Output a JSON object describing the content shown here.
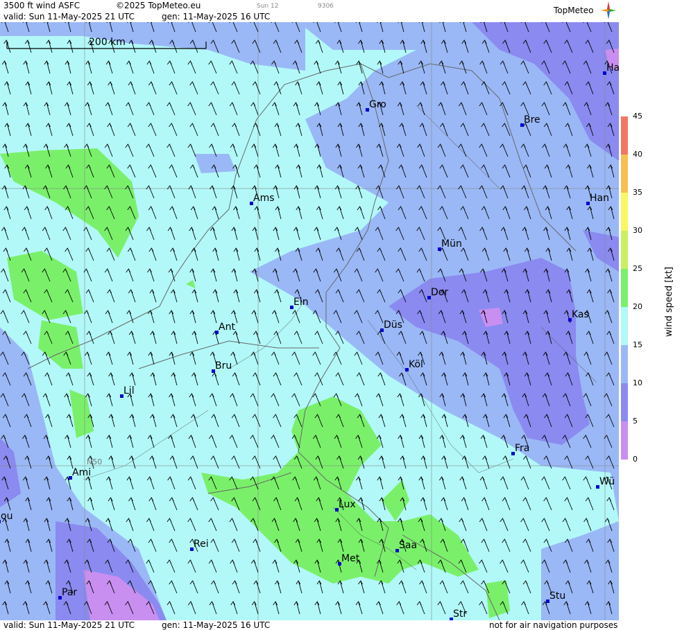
{
  "header": {
    "title": "3500 ft wind ASFC",
    "copyright": "©2025 TopMeteo.eu",
    "valid": "valid:  Sun  11-May-2025  21 UTC",
    "gen": "gen: 11-May-2025 16 UTC",
    "day_tag": "Sun 12",
    "code": "9306",
    "logo": "TopMeteo"
  },
  "footer": {
    "valid": "valid:  Sun  11-May-2025  21 UTC",
    "gen": "gen: 11-May-2025 16 UTC",
    "note": "not for air navigation purposes"
  },
  "map": {
    "scale_bar_label": "200 km",
    "lat_label": "N50",
    "cities": [
      {
        "name": "Gro"
      },
      {
        "name": "Bre"
      },
      {
        "name": "Ha"
      },
      {
        "name": "Ams"
      },
      {
        "name": "Han"
      },
      {
        "name": "Mün"
      },
      {
        "name": "Dor"
      },
      {
        "name": "Ein"
      },
      {
        "name": "Kas"
      },
      {
        "name": "Düs"
      },
      {
        "name": "Ant"
      },
      {
        "name": "Bru"
      },
      {
        "name": "Köl"
      },
      {
        "name": "Lil"
      },
      {
        "name": "Fra"
      },
      {
        "name": "Ami"
      },
      {
        "name": "Wü"
      },
      {
        "name": "ou"
      },
      {
        "name": "Lux"
      },
      {
        "name": "Rei"
      },
      {
        "name": "Saa"
      },
      {
        "name": "Met"
      },
      {
        "name": "Par"
      },
      {
        "name": "Stu"
      },
      {
        "name": "Str"
      }
    ]
  },
  "colorbar": {
    "title": "wind  speed  [kt]",
    "ticks": [
      "45",
      "40",
      "35",
      "30",
      "25",
      "20",
      "15",
      "10",
      "5",
      "0"
    ],
    "colors": {
      "0-5": "#c88ff0",
      "5-10": "#8a8af0",
      "10-15": "#9ab8f6",
      "15-20": "#b2f8f8",
      "20-25": "#7af06a",
      "25-30": "#c8f060",
      "30-35": "#f8f860",
      "35-40": "#f8c050",
      "40-45": "#f07860"
    }
  }
}
